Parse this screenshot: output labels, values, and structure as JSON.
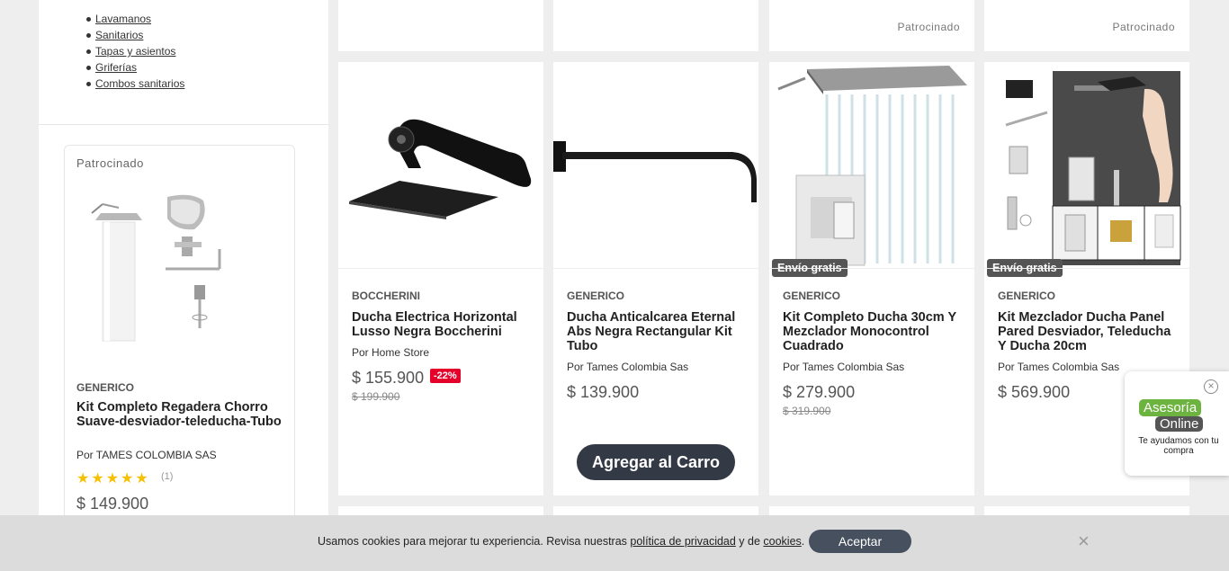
{
  "sidebar": {
    "categories": [
      "Lavamanos",
      "Sanitarios",
      "Tapas y asientos",
      "Griferías",
      "Combos sanitarios"
    ],
    "sponsored_card": {
      "sponsored_label": "Patrocinado",
      "brand": "GENERICO",
      "title": "Kit Completo Regadera Chorro Suave-desviador-teleducha-Tubo",
      "seller": "Por TAMES COLOMBIA SAS",
      "stars": "★★★★★",
      "rating": 5,
      "review_count": "(1)",
      "price": "$ 149.900"
    }
  },
  "top_cards": [
    {
      "sponsored_label": ""
    },
    {
      "sponsored_label": ""
    },
    {
      "sponsored_label": "Patrocinado"
    },
    {
      "sponsored_label": "Patrocinado"
    }
  ],
  "products": [
    {
      "brand": "BOCCHERINI",
      "title": "Ducha Electrica Horizontal Lusso Negra Boccherini",
      "seller": "Por Home Store",
      "price": "$ 155.900",
      "discount": "-22%",
      "old_price": "$ 199.900"
    },
    {
      "brand": "GENERICO",
      "title": "Ducha Anticalcarea Eternal Abs Negra Rectangular Kit Tubo",
      "seller": "Por Tames Colombia Sas",
      "price": "$ 139.900",
      "cart_label": "Agregar al Carro"
    },
    {
      "brand": "GENERICO",
      "title": "Kit Completo Ducha 30cm Y Mezclador Monocontrol Cuadrado",
      "seller": "Por Tames Colombia Sas",
      "price": "$ 279.900",
      "old_price": "$ 319.900",
      "shipping": "Envío gratis"
    },
    {
      "brand": "GENERICO",
      "title": "Kit Mezclador Ducha Panel Pared Desviador, Teleducha Y Ducha 20cm",
      "seller": "Por Tames Colombia Sas",
      "price": "$ 569.900",
      "shipping": "Envío gratis"
    }
  ],
  "chat": {
    "close": "×",
    "logo_line1": "Asesoría",
    "logo_line2": "Online",
    "subtitle": "Te ayudamos con tu compra"
  },
  "cookie_bar": {
    "text_before": "Usamos cookies para mejorar tu experiencia. Revisa nuestras ",
    "privacy_link": "política de privacidad",
    "text_middle": " y de ",
    "cookies_link": "cookies",
    "text_end": ".",
    "accept_label": "Aceptar",
    "close": "×"
  }
}
